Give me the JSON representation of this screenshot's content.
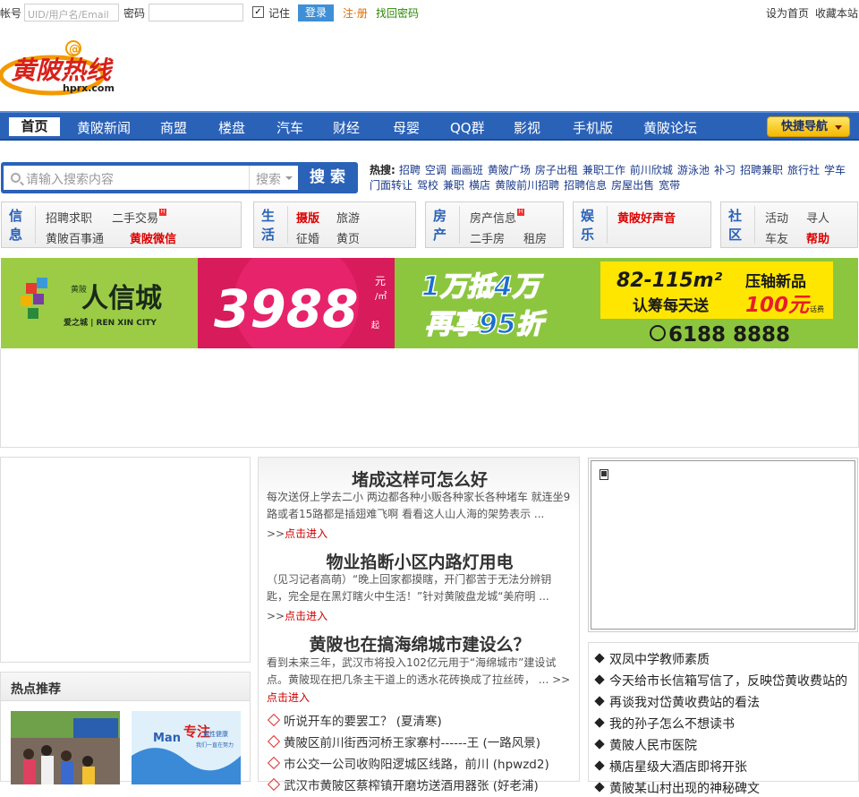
{
  "topbar": {
    "account_label": "帐号",
    "account_placeholder": "UID/用户名/Email",
    "password_label": "密码",
    "remember_label": "记住",
    "login_button": "登录",
    "register_link": "注·册",
    "recover_link": "找回密码",
    "set_home_link": "设为首页",
    "bookmark_link": "收藏本站"
  },
  "logo": {
    "text": "黄陂热线",
    "domain": "hprx.com",
    "at": "@"
  },
  "nav": {
    "items": [
      "首页",
      "黄陂新闻",
      "商盟",
      "楼盘",
      "汽车",
      "财经",
      "母婴",
      "QQ群",
      "影视",
      "手机版",
      "黄陂论坛"
    ],
    "quick_nav": "快捷导航"
  },
  "search": {
    "placeholder": "请输入搜索内容",
    "select_value": "搜索",
    "button": "搜 索"
  },
  "hot_search": {
    "label": "热搜:",
    "terms": [
      "招聘",
      "空调",
      "画画班",
      "黄陂广场",
      "房子出租",
      "兼职工作",
      "前川欣城",
      "游泳池",
      "补习",
      "招聘兼职",
      "旅行社",
      "学车",
      "门面转让",
      "驾校",
      "兼职",
      "横店",
      "黄陂前川招聘",
      "招聘信息",
      "房屋出售",
      "宽带"
    ]
  },
  "categories": {
    "info": {
      "h1": "信",
      "h2": "息",
      "a": "招聘求职",
      "b": "二手交易",
      "c": "黄陂百事通",
      "d": "黄陂微信"
    },
    "life": {
      "h1": "生",
      "h2": "活",
      "a": "摄版",
      "b": "旅游",
      "c": "征婚",
      "d": "黄页"
    },
    "house": {
      "h1": "房",
      "h2": "产",
      "a": "房产信息",
      "c": "二手房",
      "d": "租房"
    },
    "ent": {
      "h1": "娱",
      "h2": "乐",
      "a": "黄陂好声音"
    },
    "community": {
      "h1": "社",
      "h2": "区",
      "a": "活动",
      "b": "寻人",
      "c": "车友",
      "d": "帮助"
    }
  },
  "banner": {
    "brand_small": "黄陂",
    "brand": "人信城",
    "brand_sub": "爱之城 | REN XIN CITY",
    "price": "3988",
    "price_unit": "元",
    "price_unit2": "/㎡",
    "price_suffix": "起",
    "offer1": "1万抵4万",
    "offer2": "再享95折",
    "area": "82-115m²",
    "area_tag": "压轴新品",
    "gift_pre": "认筹每天送",
    "gift_amt": "100元",
    "gift_suffix": "话费",
    "phone": "6188 8888"
  },
  "hot_recommend": {
    "title": "热点推荐",
    "thumb2_text1": "Man",
    "thumb2_text2": "专注",
    "thumb2_text3": "男性健康",
    "thumb2_text4": "我们一直在努力"
  },
  "articles": [
    {
      "title": "堵成这样可怎么好",
      "desc": "每次送伢上学去二小  两边都各种小贩各种家长各种堵车  就连坐9路或者15路都是插翅难飞啊  看看这人山人海的架势表示  ...",
      "more_prefix": ">>",
      "more": "点击进入"
    },
    {
      "title": "物业掐断小区内路灯用电",
      "desc": "（见习记者高萌）“晚上回家都摸瞎，开门都苦于无法分辨钥匙，完全是在黑灯瞎火中生活！”针对黄陂盘龙城“美府明  ...",
      "more_prefix": ">>",
      "more": "点击进入"
    },
    {
      "title": "黄陂也在搞海绵城市建设么？",
      "desc": "看到未来三年，武汉市将投入102亿元用于“海绵城市”建设试点。黄陂现在把几条主干道上的透水花砖换成了拉丝砖，  ... >>",
      "more": "点击进入"
    }
  ],
  "mid_links": [
    "听说开车的要罢工？ (夏清寒)",
    "黄陂区前川街西河桥王家寨村------王 (一路风景)",
    "市公交一公司收购阳逻城区线路，前川 (hpwzd2)",
    "武汉市黄陂区蔡榨镇开磨坊送酒用器张 (好老浦)"
  ],
  "right_list": [
    "双凤中学教师素质",
    "今天给市长信箱写信了，反映岱黄收费站的",
    "再谈我对岱黄收费站的看法",
    "我的孙子怎么不想读书",
    "黄陂人民市医院",
    "横店星级大酒店即将开张",
    "黄陂某山村出现的神秘碑文"
  ]
}
